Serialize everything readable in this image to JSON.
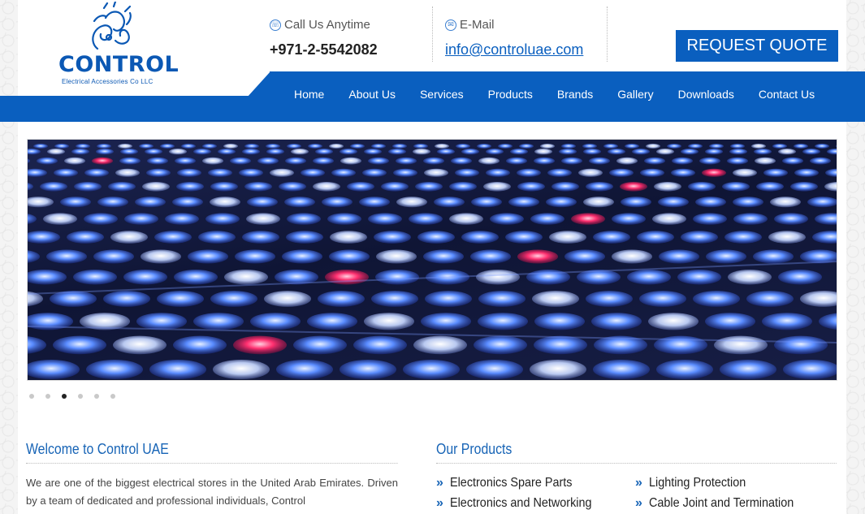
{
  "brand": {
    "logo_word": "CONTROL",
    "logo_subtitle": "Electrical Accessories Co LLC",
    "accent_color": "#0a5fbf"
  },
  "header": {
    "call_label": "Call Us Anytime",
    "call_icon": "phone-icon",
    "phone": "+971-2-5542082",
    "email_label": "E-Mail",
    "email_icon": "mail-icon",
    "email": "info@controluae.com",
    "quote_button": "REQUEST QUOTE"
  },
  "nav": {
    "items": [
      "Home",
      "About Us",
      "Services",
      "Products",
      "Brands",
      "Gallery",
      "Downloads",
      "Contact Us"
    ]
  },
  "slider": {
    "dot_count": 6,
    "active_dot": 3
  },
  "welcome": {
    "title": "Welcome to Control UAE",
    "text": "We are one of the biggest electrical stores in the United Arab Emirates. Driven by a team of dedicated and professional individuals, Control"
  },
  "products": {
    "title": "Our Products",
    "left": [
      "Electronics Spare Parts",
      "Electronics and Networking"
    ],
    "right": [
      "Lighting Protection",
      "Cable Joint and Termination"
    ]
  }
}
